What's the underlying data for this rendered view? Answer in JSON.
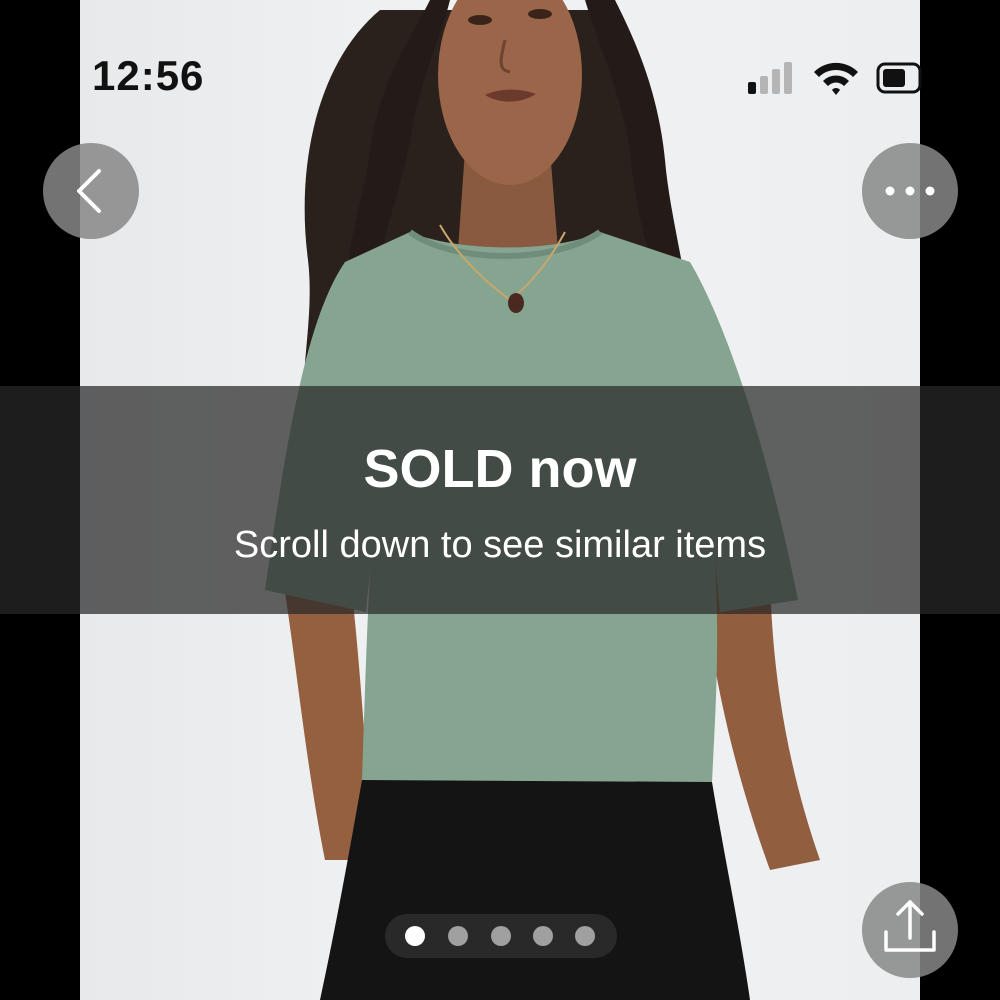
{
  "status_bar": {
    "time": "12:56",
    "signal_icon": "cellular-signal-icon",
    "wifi_icon": "wifi-icon",
    "battery_icon": "battery-icon"
  },
  "toolbar": {
    "back_icon": "chevron-left-icon",
    "more_icon": "ellipsis-icon"
  },
  "listing_overlay": {
    "title": "SOLD now",
    "subtitle": "Scroll down to see similar items"
  },
  "carousel": {
    "image_count": 5,
    "active_index": 0
  },
  "share": {
    "icon": "share-icon"
  },
  "colors": {
    "overlay": "#282828",
    "button_bg": "#878787",
    "top_color": "#86a591",
    "pants_color": "#141414"
  }
}
